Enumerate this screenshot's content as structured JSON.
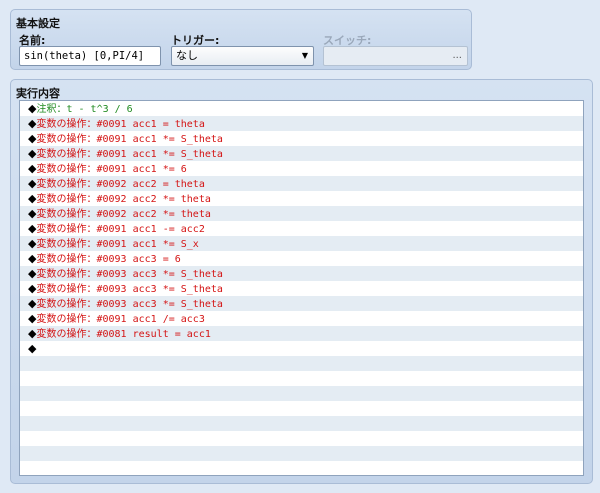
{
  "basic_settings": {
    "title": "基本設定",
    "name_label": "名前:",
    "name_value": "sin(theta) [0,PI/4]",
    "trigger_label": "トリガー:",
    "trigger_value": "なし",
    "switch_label": "スイッチ:",
    "switch_value": "",
    "switch_button": "..."
  },
  "execution": {
    "title": "実行内容",
    "commands": [
      {
        "text": "◆注釈：t - t^3 / 6",
        "kind": "comment"
      },
      {
        "text": "◆変数の操作：#0091 acc1 = theta",
        "kind": "var"
      },
      {
        "text": "◆変数の操作：#0091 acc1 *= S_theta",
        "kind": "var"
      },
      {
        "text": "◆変数の操作：#0091 acc1 *= S_theta",
        "kind": "var"
      },
      {
        "text": "◆変数の操作：#0091 acc1 *= 6",
        "kind": "var"
      },
      {
        "text": "◆変数の操作：#0092 acc2 = theta",
        "kind": "var"
      },
      {
        "text": "◆変数の操作：#0092 acc2 *= theta",
        "kind": "var"
      },
      {
        "text": "◆変数の操作：#0092 acc2 *= theta",
        "kind": "var"
      },
      {
        "text": "◆変数の操作：#0091 acc1 -= acc2",
        "kind": "var"
      },
      {
        "text": "◆変数の操作：#0091 acc1 *= S_x",
        "kind": "var"
      },
      {
        "text": "◆変数の操作：#0093 acc3 = 6",
        "kind": "var"
      },
      {
        "text": "◆変数の操作：#0093 acc3 *= S_theta",
        "kind": "var"
      },
      {
        "text": "◆変数の操作：#0093 acc3 *= S_theta",
        "kind": "var"
      },
      {
        "text": "◆変数の操作：#0093 acc3 *= S_theta",
        "kind": "var"
      },
      {
        "text": "◆変数の操作：#0091 acc1 /= acc3",
        "kind": "var"
      },
      {
        "text": "◆変数の操作：#0081 result = acc1",
        "kind": "var"
      },
      {
        "text": "◆",
        "kind": "empty"
      }
    ]
  }
}
